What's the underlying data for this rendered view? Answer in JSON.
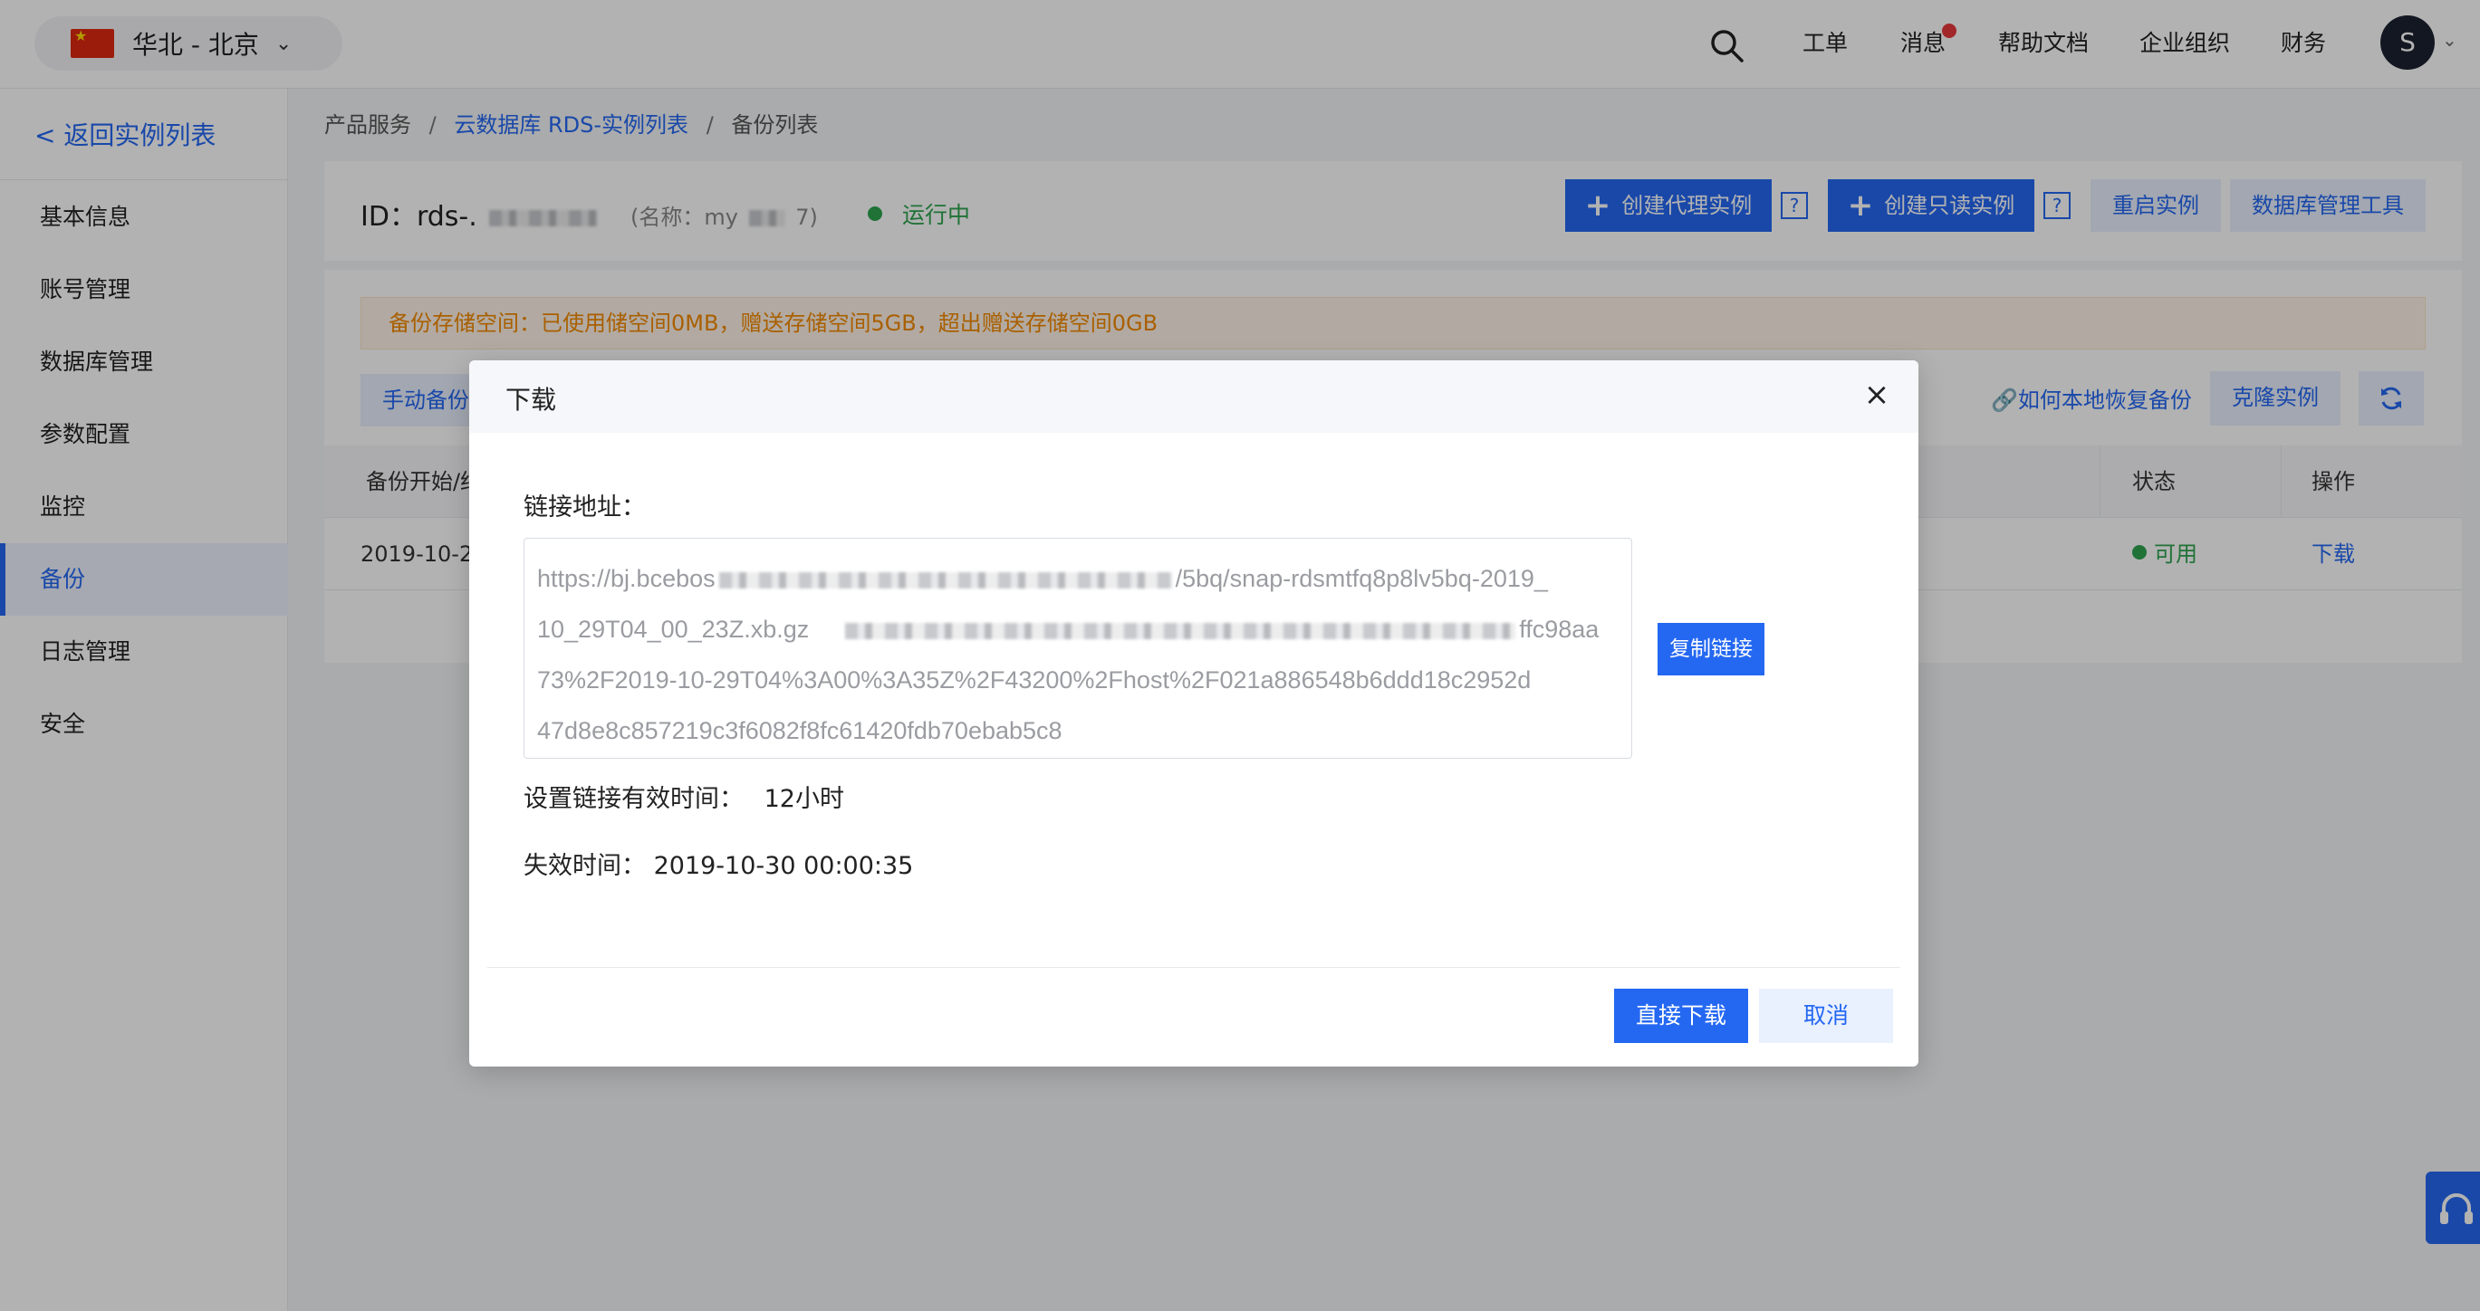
{
  "header": {
    "region": "华北 - 北京",
    "nav": {
      "ticket": "工单",
      "messages": "消息",
      "help_docs": "帮助文档",
      "org": "企业组织",
      "finance": "财务"
    },
    "avatar_letter": "S"
  },
  "sidebar": {
    "back": "< 返回实例列表",
    "items": [
      "基本信息",
      "账号管理",
      "数据库管理",
      "参数配置",
      "监控",
      "备份",
      "日志管理",
      "安全"
    ],
    "active": "备份"
  },
  "breadcrumb": {
    "root": "产品服务",
    "middle": "云数据库 RDS-实例列表",
    "current": "备份列表"
  },
  "instance": {
    "id_prefix": "ID：rds-.",
    "name_prefix": "(名称：my",
    "name_suffix": "7)",
    "status": "运行中",
    "buttons": {
      "create_proxy": "创建代理实例",
      "create_readonly": "创建只读实例",
      "help": "?",
      "restart": "重启实例",
      "db_tool": "数据库管理工具"
    }
  },
  "backup": {
    "notice": "备份存储空间：已使用储空间0MB，赠送存储空间5GB，超出赠送存储空间0GB",
    "manual_button": "手动备份",
    "howto_link": "如何本地恢复备份",
    "clone_button": "克隆实例",
    "columns": {
      "start_time": "备份开始/结",
      "status": "状态",
      "action": "操作"
    },
    "row": {
      "start_time": "2019-10-2",
      "status": "可用",
      "action": "下载"
    }
  },
  "modal": {
    "title": "下载",
    "close": "×",
    "url_label": "链接地址：",
    "url_lines": [
      {
        "start": "https://bj.bcebos",
        "end": "/5bq/snap-rdsmtfq8p8lv5bq-2019_"
      },
      {
        "start": "10_29T04_00_23Z.xb.gz",
        "end": "ffc98aa"
      },
      {
        "start": "73%2F2019-10-29T04%3A00%3A35Z%2F43200%2Fhost%2F021a886548b6ddd18c2952d",
        "end": ""
      },
      {
        "start": "47d8e8c857219c3f6082f8fc61420fdb70ebab5c8",
        "end": ""
      }
    ],
    "copy_button": "复制链接",
    "validity_label": "设置链接有效时间：",
    "validity_value": "12小时",
    "expire_label": "失效时间：",
    "expire_value": "2019-10-30 00:00:35",
    "download_button": "直接下载",
    "cancel_button": "取消"
  }
}
